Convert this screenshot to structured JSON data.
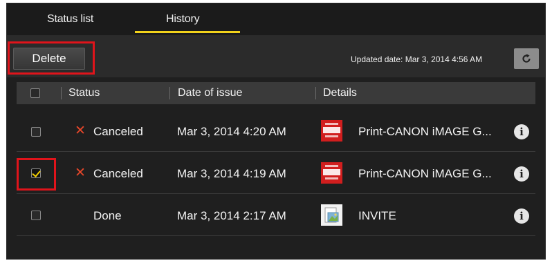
{
  "tabs": {
    "status_list": "Status list",
    "history": "History"
  },
  "toolbar": {
    "delete_label": "Delete",
    "updated_text": "Updated date: Mar 3, 2014 4:56 AM",
    "refresh_icon": "refresh-icon"
  },
  "table": {
    "headers": {
      "status": "Status",
      "date": "Date of issue",
      "details": "Details"
    },
    "rows": [
      {
        "checked": false,
        "status": "Canceled",
        "status_icon": "x-icon",
        "date": "Mar 3, 2014 4:20 AM",
        "thumb": "canon-image-gateway-thumb",
        "details": "Print-CANON iMAGE G..."
      },
      {
        "checked": true,
        "status": "Canceled",
        "status_icon": "x-icon",
        "date": "Mar 3, 2014 4:19 AM",
        "thumb": "canon-image-gateway-thumb",
        "details": "Print-CANON iMAGE G..."
      },
      {
        "checked": false,
        "status": "Done",
        "status_icon": "",
        "date": "Mar 3, 2014 2:17 AM",
        "thumb": "document-image-thumb",
        "details": "INVITE"
      }
    ]
  },
  "colors": {
    "accent_yellow": "#f2d21b",
    "highlight_red": "#e0141b",
    "cancel_red": "#e8472a"
  }
}
